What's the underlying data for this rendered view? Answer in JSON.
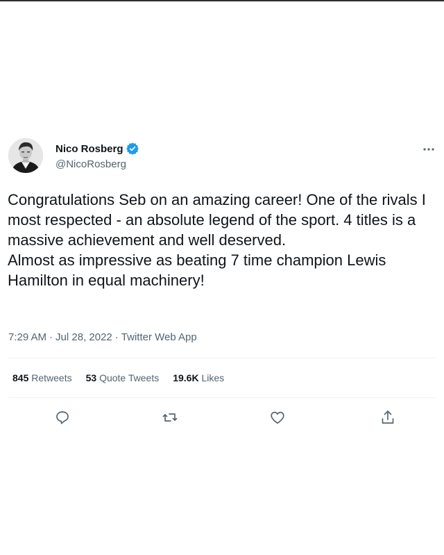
{
  "author": {
    "display_name": "Nico Rosberg",
    "handle": "@NicoRosberg",
    "avatar_icon": "person-avatar",
    "verified_icon": "verified-badge-icon",
    "verified_color": "#1d9bf0"
  },
  "tweet": {
    "lines": [
      "Congratulations Seb on an amazing career! One of the rivals I most respected - an absolute legend of the sport. 4 titles is a massive achievement and well deserved.",
      "Almost as impressive as beating 7 time champion Lewis Hamilton in equal machinery!"
    ]
  },
  "meta": {
    "time": "7:29 AM",
    "sep1": "·",
    "date": "Jul 28, 2022",
    "sep2": "·",
    "source": "Twitter Web App"
  },
  "stats": {
    "retweets_count": "845",
    "retweets_label": "Retweets",
    "quote_count": "53",
    "quote_label": "Quote Tweets",
    "likes_count": "19.6K",
    "likes_label": "Likes"
  },
  "actions": {
    "reply_icon": "reply-icon",
    "retweet_icon": "retweet-icon",
    "like_icon": "heart-icon",
    "share_icon": "share-icon"
  },
  "colors": {
    "text": "#0f1419",
    "secondary": "#536471",
    "divider": "#eff3f4"
  }
}
